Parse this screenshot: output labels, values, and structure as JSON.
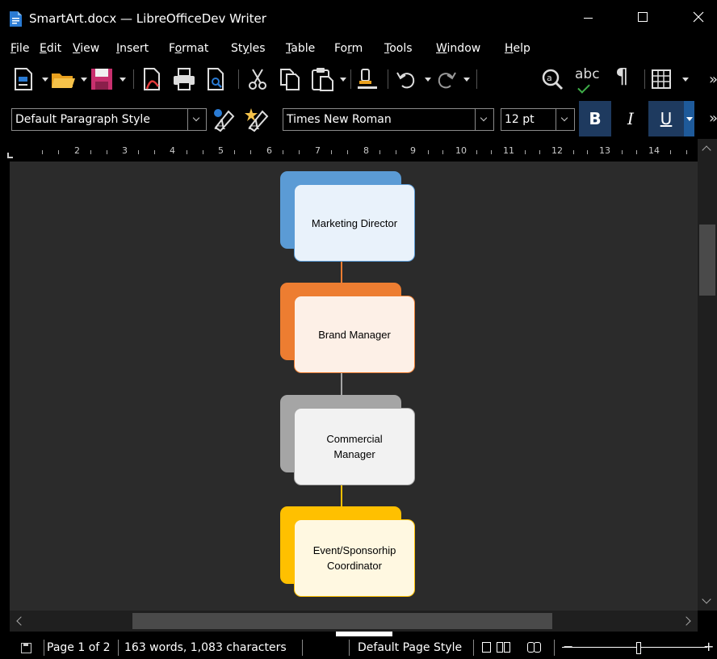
{
  "window": {
    "title": "SmartArt.docx — LibreOfficeDev Writer",
    "controls": {
      "minimize": "—",
      "maximize": "☐",
      "close": "✕"
    }
  },
  "menu": {
    "items": [
      {
        "label": "File",
        "hot": "F",
        "rest": "ile"
      },
      {
        "label": "Edit",
        "hot": "E",
        "rest": "dit"
      },
      {
        "label": "View",
        "hot": "V",
        "rest": "iew"
      },
      {
        "label": "Insert",
        "hot": "I",
        "rest": "nsert"
      },
      {
        "label": "Format",
        "pre": "F",
        "hot": "o",
        "rest": "rmat"
      },
      {
        "label": "Styles",
        "pre": "St",
        "hot": "y",
        "rest": "les"
      },
      {
        "label": "Table",
        "hot": "T",
        "rest": "able"
      },
      {
        "label": "Form",
        "pre": "Fo",
        "hot": "r",
        "rest": "m"
      },
      {
        "label": "Tools",
        "hot": "T",
        "rest": "ools"
      },
      {
        "label": "Window",
        "hot": "W",
        "rest": "indow"
      },
      {
        "label": "Help",
        "hot": "H",
        "rest": "elp"
      }
    ]
  },
  "toolbar": {
    "spelling_label": "abc",
    "formatting_marks": "¶",
    "more": "»"
  },
  "formatting": {
    "paragraph_style": "Default Paragraph Style",
    "font_name": "Times New Roman",
    "font_size": "12 pt",
    "bold": "B",
    "italic": "I",
    "underline": "U"
  },
  "ruler": {
    "numbers": [
      "2",
      "3",
      "4",
      "5",
      "6",
      "7",
      "8",
      "9",
      "10",
      "11",
      "12",
      "13",
      "14"
    ]
  },
  "smartart": {
    "nodes": [
      {
        "text": "Marketing Director",
        "accent": "#5b9bd5",
        "fill": "#e9f2fb"
      },
      {
        "text": "Brand Manager",
        "accent": "#ed7d31",
        "fill": "#fdf0e7"
      },
      {
        "text": "Commercial Manager",
        "accent": "#a5a5a5",
        "fill": "#f2f2f2"
      },
      {
        "text": "Event/Sponsorhip Coordinator",
        "accent": "#ffc000",
        "fill": "#fff8e1"
      }
    ]
  },
  "status": {
    "page": "Page 1 of 2",
    "words": "163 words, 1,083 characters",
    "page_style": "Default Page Style",
    "zoom_minus": "−",
    "zoom_plus": "+"
  }
}
